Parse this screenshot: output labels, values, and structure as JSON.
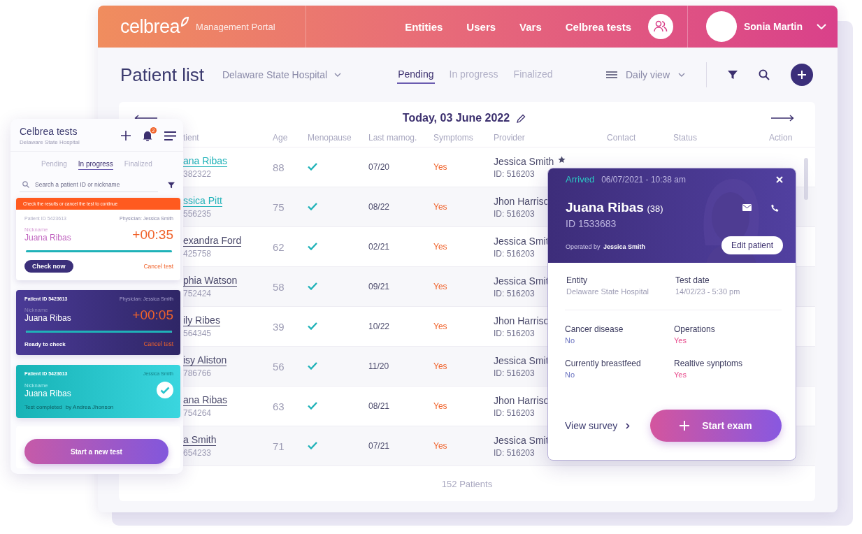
{
  "header": {
    "logo": "celbrea",
    "portal": "Management Portal",
    "nav": [
      {
        "label": "Entities"
      },
      {
        "label": "Users"
      },
      {
        "label": "Vars"
      },
      {
        "label": "Celbrea tests"
      }
    ],
    "user": "Sonia Martin"
  },
  "toolbar": {
    "title": "Patient list",
    "entity": "Delaware State Hospital",
    "tabs": [
      {
        "label": "Pending",
        "selected": true
      },
      {
        "label": "In progress",
        "selected": false
      },
      {
        "label": "Finalized",
        "selected": false
      }
    ],
    "view": "Daily view"
  },
  "date": "Today, 03 June 2022",
  "table": {
    "columns": [
      "tient",
      "Age",
      "Menopause",
      "Last mamog.",
      "Symptoms",
      "Provider",
      "Contact",
      "Status",
      "Action"
    ],
    "rows": [
      {
        "name": "ana Ribas",
        "id": "382322",
        "color": "#1fb2b8",
        "age": "88",
        "menopause": true,
        "last": "07/20",
        "symptoms": "Yes",
        "provider": "Jessica Smith",
        "provider_id": "ID: 516203",
        "starred": true
      },
      {
        "name": "ssica Pitt",
        "id": "556235",
        "color": "#1fb2b8",
        "age": "75",
        "menopause": true,
        "last": "08/22",
        "symptoms": "Yes",
        "provider": "Jhon Harriso",
        "provider_id": "ID: 516203",
        "starred": false
      },
      {
        "name": "exandra Ford",
        "id": "425758",
        "color": "#4b4a6b",
        "age": "62",
        "menopause": true,
        "last": "02/21",
        "symptoms": "Yes",
        "provider": "Jessica Smit",
        "provider_id": "ID: 516203",
        "starred": false
      },
      {
        "name": "phia Watson",
        "id": "752424",
        "color": "#4b4a6b",
        "age": "58",
        "menopause": true,
        "last": "09/21",
        "symptoms": "Yes",
        "provider": "Jessica Smit",
        "provider_id": "ID: 516203",
        "starred": false
      },
      {
        "name": "ily Ribes",
        "id": "564345",
        "color": "#4b4a6b",
        "age": "39",
        "menopause": true,
        "last": "10/22",
        "symptoms": "Yes",
        "provider": "Jhon Harriso",
        "provider_id": "ID: 516203",
        "starred": false
      },
      {
        "name": "isy Aliston",
        "id": "786766",
        "color": "#4b4a6b",
        "age": "56",
        "menopause": true,
        "last": "11/20",
        "symptoms": "Yes",
        "provider": "Jessica Smit",
        "provider_id": "ID: 516203",
        "starred": false
      },
      {
        "name": "ana Ribas",
        "id": "754264",
        "color": "#4b4a6b",
        "age": "63",
        "menopause": true,
        "last": "08/21",
        "symptoms": "Yes",
        "provider": "Jhon Harriso",
        "provider_id": "ID: 516203",
        "starred": false
      },
      {
        "name": "a Smith",
        "id": "654233",
        "color": "#4b4a6b",
        "age": "71",
        "menopause": true,
        "last": "07/21",
        "symptoms": "Yes",
        "provider": "Jessica Smit",
        "provider_id": "ID: 516203",
        "starred": false
      }
    ],
    "footer": "152 Patients"
  },
  "mobile": {
    "title": "Celbrea tests",
    "subtitle": "Delaware State Hospital",
    "badge": "2",
    "tabs": [
      {
        "label": "Pending",
        "selected": false
      },
      {
        "label": "In progress",
        "selected": true
      },
      {
        "label": "Finalized",
        "selected": false
      }
    ],
    "search": {
      "placeholder": "Search a patient ID or nickname"
    },
    "cards": [
      {
        "kind": "alert",
        "banner": "Check the results or cancel the test to continue",
        "patient_id": "Patient ID 5423613",
        "physician": "Physician: Jessica Smith",
        "nickname_label": "Nickname",
        "nickname": "Juana Ribas",
        "timer": "+00:35",
        "level": 1,
        "action": "Check now",
        "cancel": "Cancel test"
      },
      {
        "kind": "ready",
        "patient_id": "Patient ID 5423613",
        "physician": "Physician: Jessica Smith",
        "nickname_label": "Nickname",
        "nickname": "Juana Ribas",
        "timer": "+00:05",
        "level": 1,
        "status": "Ready to check",
        "cancel": "Cancel test"
      },
      {
        "kind": "completed",
        "patient_id": "Patient ID 5423613",
        "physician": "Jessica Smith",
        "nickname_label": "Nickname",
        "nickname": "Juana Ribas",
        "status": "Test completed",
        "by": "by Andrea Jhonson"
      }
    ],
    "new_test": "Start a new test"
  },
  "popup": {
    "status": "Arrived",
    "datetime": "06/07/2021 - 10:38 am",
    "name": "Juana Ribas",
    "age": "(38)",
    "id": "ID 1533683",
    "operated_label": "Operated by",
    "operator": "Jessica Smith",
    "edit": "Edit patient",
    "summary": [
      {
        "label": "Entity",
        "value": "Delaware State Hospital"
      },
      {
        "label": "Test date",
        "value": "14/02/23 - 5:30 pm"
      }
    ],
    "answers": [
      {
        "label": "Cancer disease",
        "value": "No",
        "alert": false
      },
      {
        "label": "Operations",
        "value": "Yes",
        "alert": true
      },
      {
        "label": "Currently breastfeed",
        "value": "No",
        "alert": false
      },
      {
        "label": "Realtive synptoms",
        "value": "Yes",
        "alert": true
      }
    ],
    "survey": "View survey",
    "start": "Start exam"
  }
}
